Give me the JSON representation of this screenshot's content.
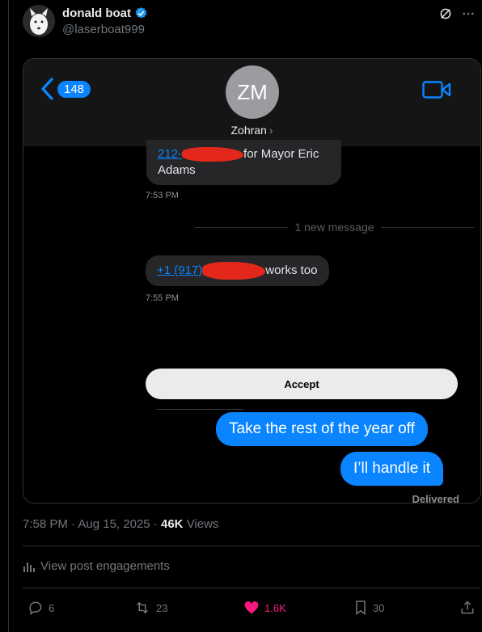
{
  "author": {
    "name": "donald boat",
    "handle": "@laserboat999"
  },
  "screenshot": {
    "back_count": "148",
    "avatar_initials": "ZM",
    "contact_name": "Zohran",
    "contact_chevron": "›",
    "msg1": {
      "link": "212-",
      "text_after": "for Mayor Eric",
      "line2": "Adams",
      "time": "7:53 PM"
    },
    "new_message": "1 new message",
    "msg2": {
      "link": "+1 (917)",
      "text_after": "works too",
      "time": "7:55 PM"
    },
    "accept_label": "Accept",
    "sent1": "Take the rest of the year off",
    "sent2": "I’ll handle it",
    "delivered": "Delivered"
  },
  "post_meta": {
    "time": "7:58 PM",
    "date": "Aug 15, 2025",
    "views_count": "46K",
    "views_label": "Views"
  },
  "engagements_label": "View post engagements",
  "actions": {
    "replies": "6",
    "reposts": "23",
    "likes": "1.6K",
    "bookmarks": "30"
  },
  "colors": {
    "imessage_blue": "#0a84ff",
    "like_pink": "#f91880",
    "x_blue": "#1d9bf0",
    "muted": "#71767b"
  }
}
